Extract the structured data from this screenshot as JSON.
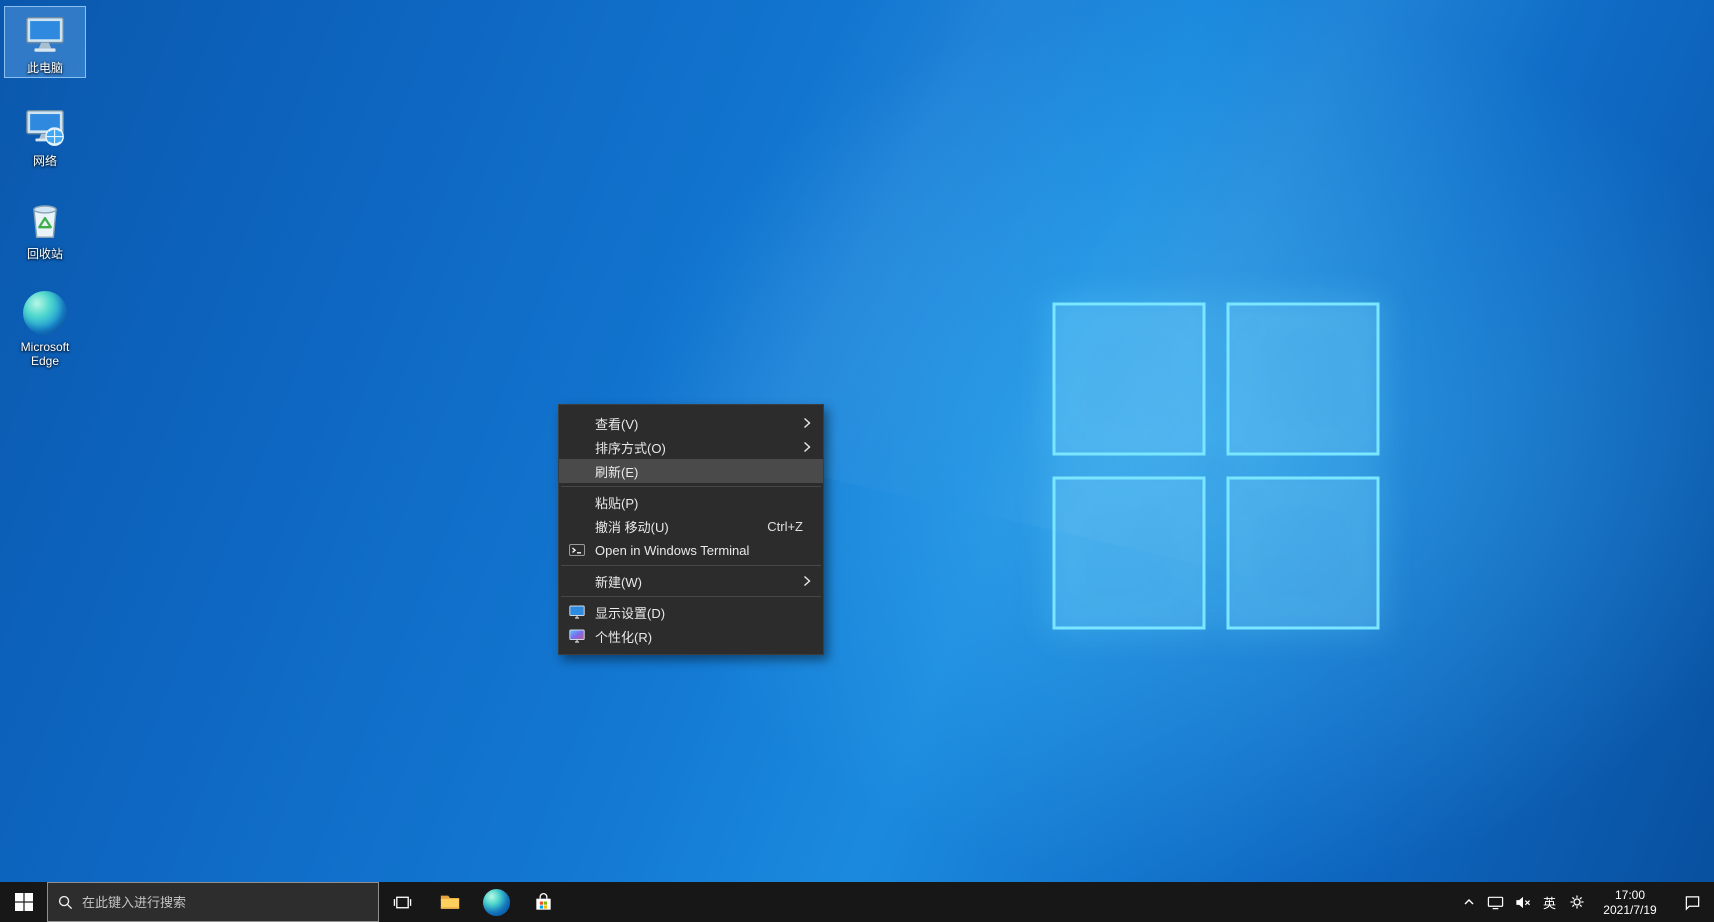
{
  "colors": {
    "wallpaper_blue": "#1379d3",
    "logo_glow": "#7ae6ff",
    "menu_bg": "#2c2c2c",
    "menu_highlight": "#4a4a4a",
    "taskbar_bg": "#171717"
  },
  "desktop": {
    "icons": [
      {
        "label": "此电脑",
        "selected": true
      },
      {
        "label": "网络",
        "selected": false
      },
      {
        "label": "回收站",
        "selected": false
      },
      {
        "label": "Microsoft Edge",
        "selected": false
      }
    ]
  },
  "context_menu": {
    "items": [
      {
        "label": "查看(V)",
        "submenu": true
      },
      {
        "label": "排序方式(O)",
        "submenu": true
      },
      {
        "label": "刷新(E)",
        "highlighted": true
      },
      {
        "type": "separator"
      },
      {
        "label": "粘贴(P)"
      },
      {
        "label": "撤消 移动(U)",
        "shortcut": "Ctrl+Z"
      },
      {
        "label": "Open in Windows Terminal",
        "icon": "windows-terminal"
      },
      {
        "type": "separator"
      },
      {
        "label": "新建(W)",
        "submenu": true
      },
      {
        "type": "separator"
      },
      {
        "label": "显示设置(D)",
        "icon": "display-settings"
      },
      {
        "label": "个性化(R)",
        "icon": "personalization"
      }
    ]
  },
  "taskbar": {
    "search_placeholder": "在此键入进行搜索",
    "tray": {
      "ime": "英",
      "time": "17:00",
      "date": "2021/7/19"
    }
  }
}
